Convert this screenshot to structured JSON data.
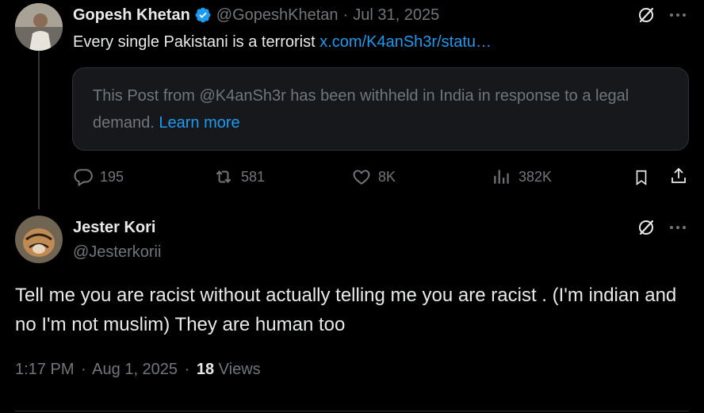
{
  "parent_tweet": {
    "author_name": "Gopesh Khetan",
    "handle": "@GopeshKhetan",
    "dot": "·",
    "date": "Jul 31, 2025",
    "text": "Every single Pakistani is a terrorist",
    "link_text": "x.com/K4anSh3r/statu…",
    "quote_notice": "This Post from @K4anSh3r has been withheld in India in response to a legal demand.",
    "quote_link": "Learn more",
    "stats": {
      "replies": "195",
      "reposts": "581",
      "likes": "8K",
      "views": "382K"
    }
  },
  "reply_tweet": {
    "author_name": "Jester Kori",
    "handle": "@Jesterkorii",
    "text": "Tell me you are racist without actually telling me you are racist . (I'm indian and no I'm not muslim) They are human too",
    "time": "1:17 PM",
    "dot1": "·",
    "date": "Aug 1, 2025",
    "dot2": "·",
    "views_count": "18",
    "views_label": "Views"
  },
  "colors": {
    "verified": "#1d9bf0",
    "link": "#1d9bf0",
    "muted": "#71767b"
  },
  "icons": [
    "grok-icon",
    "more-icon",
    "reply-icon",
    "repost-icon",
    "like-icon",
    "views-icon",
    "bookmark-icon",
    "share-icon",
    "verified-badge-icon"
  ]
}
